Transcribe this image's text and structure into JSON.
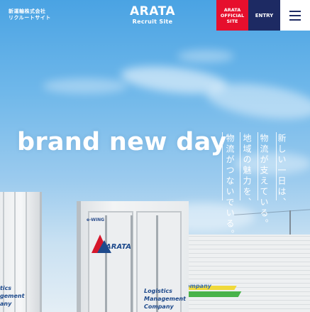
{
  "header": {
    "company_name_line1": "新運輸株式会社",
    "company_name_line2": "リクルートサイト",
    "logo_main": "ARATA",
    "logo_sub": "Recruit Site",
    "official_site_line1": "ARATA",
    "official_site_line2": "OFFICIAL",
    "official_site_line3": "SITE",
    "entry_label": "ENTRY",
    "menu_icon": "hamburger-icon"
  },
  "hero": {
    "heading": "brand new day",
    "vertical_lines": [
      "新しい一日は、",
      "物流が支えている。",
      "地域の魅力を、",
      "物流がつないでいる。"
    ],
    "truck_wing_label": "e-WING",
    "truck_logo_text": "ARATA",
    "truck_tagline": [
      "Logistics",
      "Management",
      "Company"
    ],
    "left_truck_tagline": [
      "tics",
      "gement",
      "any"
    ],
    "warehouse_text": "ompany"
  },
  "colors": {
    "official_red": "#e60f2d",
    "entry_navy": "#1d2a63",
    "sky_blue": "#6cb3e6"
  }
}
